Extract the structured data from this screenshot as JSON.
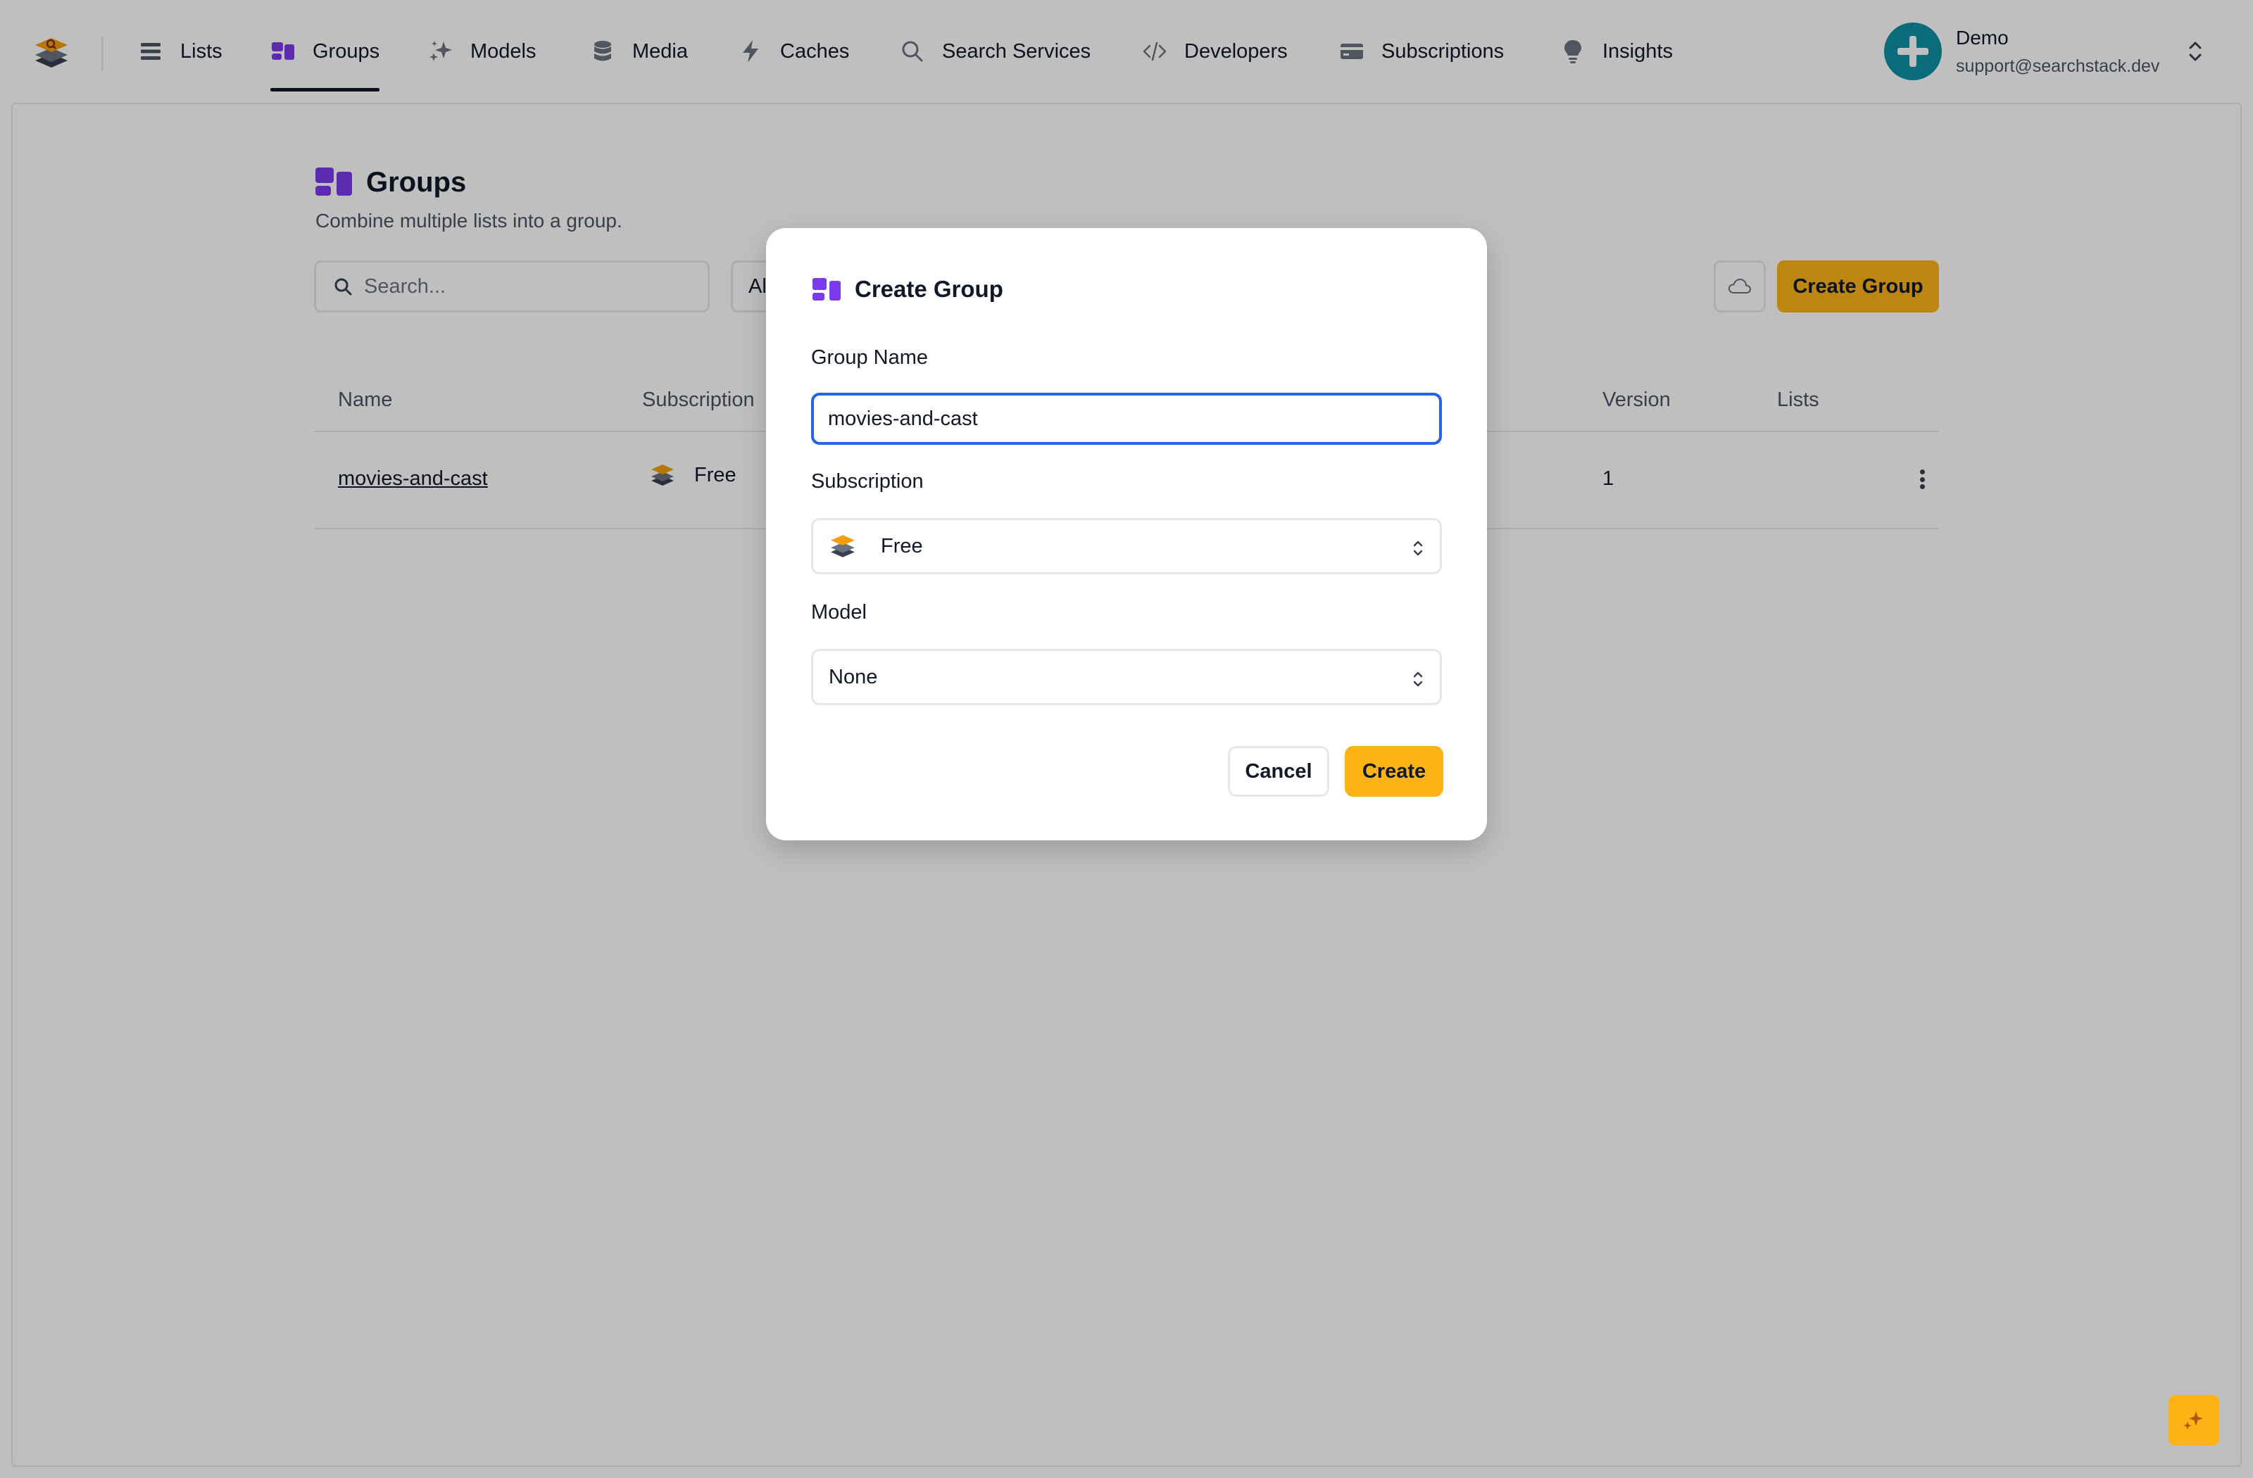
{
  "nav": {
    "items": [
      {
        "label": "Lists",
        "icon": "list-icon"
      },
      {
        "label": "Groups",
        "icon": "groups-icon",
        "active": true
      },
      {
        "label": "Models",
        "icon": "sparkles-icon"
      },
      {
        "label": "Media",
        "icon": "database-icon"
      },
      {
        "label": "Caches",
        "icon": "bolt-icon"
      },
      {
        "label": "Search Services",
        "icon": "search-icon"
      },
      {
        "label": "Developers",
        "icon": "code-icon"
      },
      {
        "label": "Subscriptions",
        "icon": "credit-card-icon"
      },
      {
        "label": "Insights",
        "icon": "lightbulb-icon"
      }
    ]
  },
  "user": {
    "name": "Demo",
    "email": "support@searchstack.dev"
  },
  "page": {
    "title": "Groups",
    "subtitle": "Combine multiple lists into a group.",
    "search_placeholder": "Search...",
    "filter_label": "All",
    "create_label": "Create Group"
  },
  "table": {
    "headers": [
      "Name",
      "Subscription",
      "Version",
      "Lists"
    ],
    "rows": [
      {
        "name": "movies-and-cast",
        "subscription": "Free",
        "version": "1",
        "lists": ""
      }
    ]
  },
  "modal": {
    "title": "Create Group",
    "group_name_label": "Group Name",
    "group_name_value": "movies-and-cast",
    "subscription_label": "Subscription",
    "subscription_value": "Free",
    "model_label": "Model",
    "model_value": "None",
    "cancel_label": "Cancel",
    "create_label": "Create"
  },
  "colors": {
    "accent": "#fcb316",
    "groups_purple": "#7c3aed",
    "focus_blue": "#2563eb",
    "avatar_teal": "#0e8fa3"
  }
}
